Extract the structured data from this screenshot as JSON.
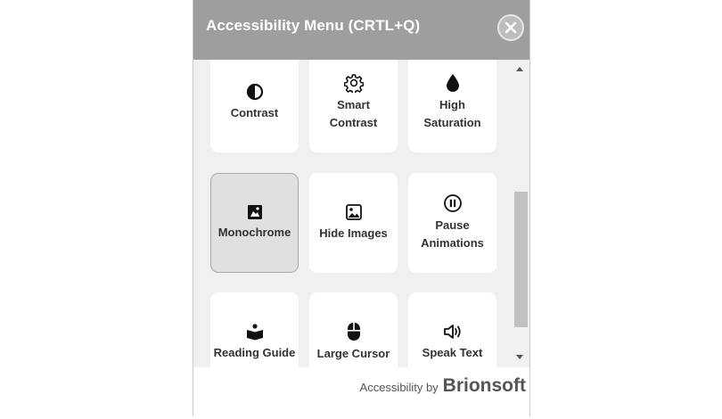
{
  "header": {
    "title": "Accessibility Menu (CRTL+Q)",
    "close_icon": "close-icon"
  },
  "cards": [
    {
      "label": "Contrast",
      "icon": "contrast-icon"
    },
    {
      "label": "Smart\nContrast",
      "icon": "gear-icon"
    },
    {
      "label": "High\nSaturation",
      "icon": "droplet-icon"
    },
    {
      "label": "Monochrome",
      "icon": "monochrome-icon",
      "active": true
    },
    {
      "label": "Hide Images",
      "icon": "image-icon"
    },
    {
      "label": "Pause\nAnimations",
      "icon": "pause-icon"
    },
    {
      "label": "Reading Guide",
      "icon": "reading-guide-icon"
    },
    {
      "label": "Large Cursor",
      "icon": "mouse-icon"
    },
    {
      "label": "Speak Text",
      "icon": "speaker-icon"
    }
  ],
  "footer": {
    "by_text": "Accessibility by",
    "brand": "Brionsoft"
  },
  "colors": {
    "header_bg": "#9e9e9e",
    "content_bg": "#f0f0f0",
    "active_card_bg": "#e0e0e0"
  }
}
